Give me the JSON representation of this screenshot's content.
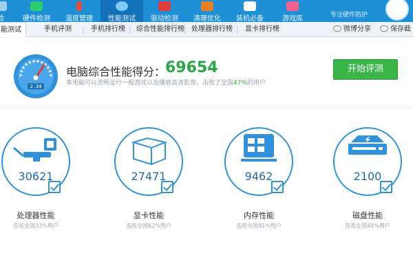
{
  "nav": {
    "items": [
      {
        "label": "检",
        "icon": "partial-icon"
      },
      {
        "label": "硬件检测",
        "icon": "hardware-icon"
      },
      {
        "label": "温度管理",
        "icon": "thermometer-icon"
      },
      {
        "label": "性能测试",
        "icon": "performance-icon"
      },
      {
        "label": "驱动检测",
        "icon": "driver-icon"
      },
      {
        "label": "清理优化",
        "icon": "cleanup-icon"
      },
      {
        "label": "装机必备",
        "icon": "essentials-icon"
      },
      {
        "label": "游戏库",
        "icon": "game-icon"
      }
    ],
    "active_index": 3,
    "slogan": "专注硬件防护"
  },
  "tabs": {
    "items": [
      "能测试",
      "手机评测",
      "手机排行榜",
      "综合性能排行榜",
      "处理器排行榜",
      "显卡排行榜"
    ],
    "share_weibo": "微博分享",
    "save_screenshot": "保存截"
  },
  "summary": {
    "label": "电脑综合性能得分：",
    "score": "69654",
    "desc_before": "本电脑可以流畅运行一般游戏以及播放高清影音，击败了全国",
    "desc_pct": "47%",
    "desc_after": "的用户",
    "gauge_reading": "2.34",
    "start_button": "开始评测"
  },
  "components": [
    {
      "name": "处理器性能",
      "score": "30621",
      "sub": "击败全国33%用户",
      "icon": "cpu-monitor-icon"
    },
    {
      "name": "显卡性能",
      "score": "27471",
      "sub": "击败全国62%用户",
      "icon": "gpu-cube-icon"
    },
    {
      "name": "内存性能",
      "score": "9462",
      "sub": "击败全国91%用户",
      "icon": "memory-chip-icon"
    },
    {
      "name": "磁盘性能",
      "score": "2100",
      "sub": "击败全国48%用户",
      "icon": "disk-drive-icon"
    }
  ],
  "colors": {
    "topbar": "#1f8fd6",
    "accent_blue": "#2f92da",
    "score_green": "#27a844",
    "button_green": "#3bb54a"
  }
}
